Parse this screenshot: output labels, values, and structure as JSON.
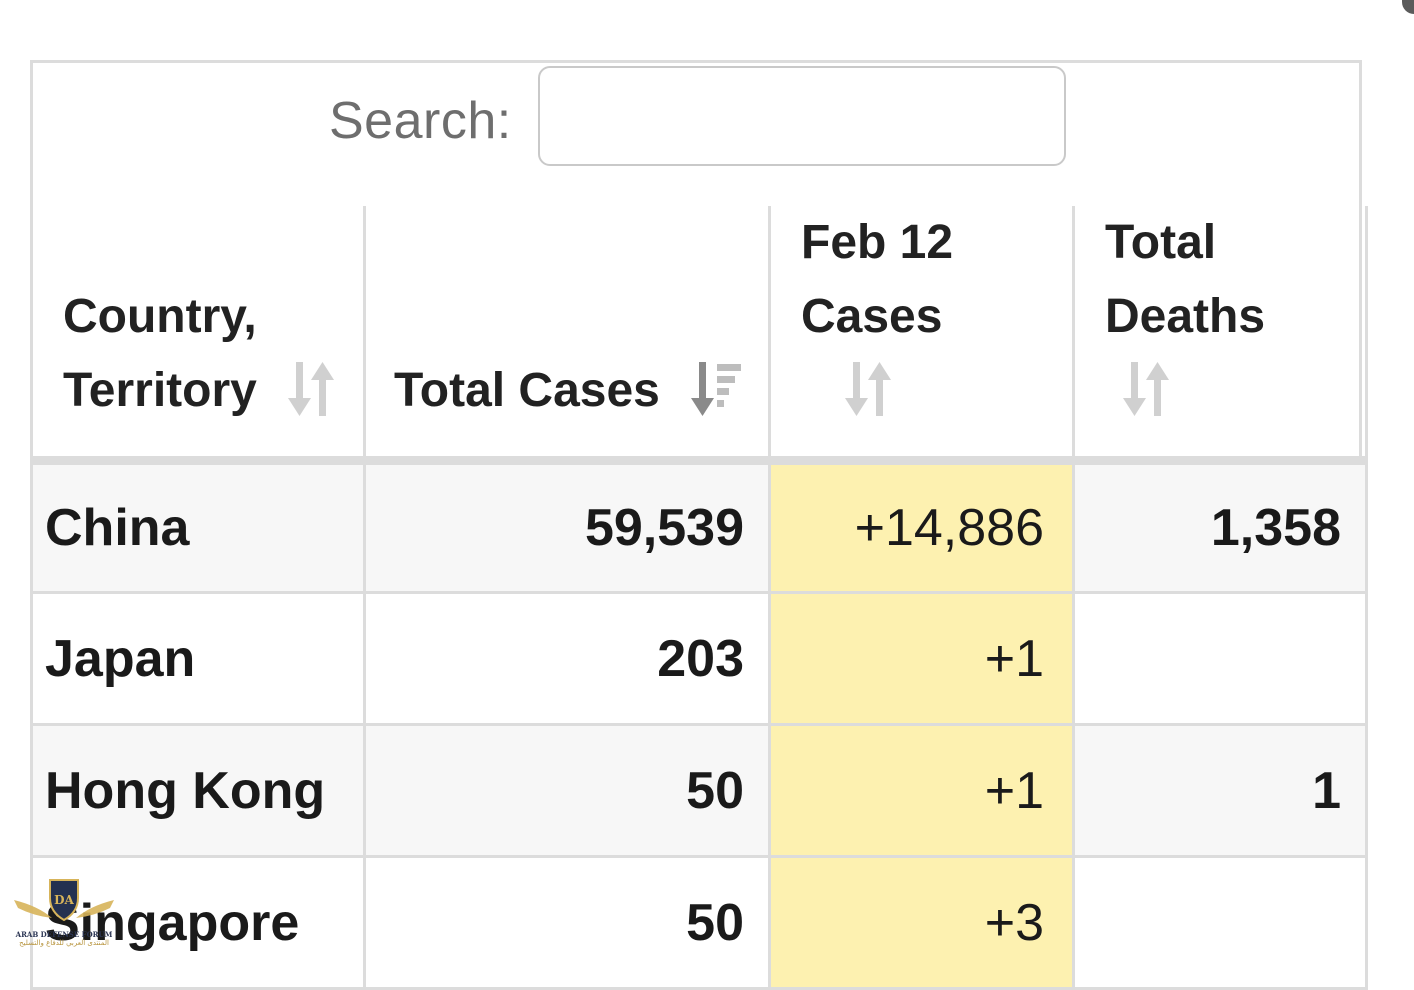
{
  "search": {
    "label": "Search:",
    "value": "",
    "placeholder": ""
  },
  "table": {
    "columns": [
      {
        "line1": "Country,",
        "line2": "Territory",
        "sort": "unsorted"
      },
      {
        "line1": "",
        "line2": "Total Cases",
        "sort": "descending"
      },
      {
        "line1": "Feb 12",
        "line2": "Cases",
        "sort": "unsorted"
      },
      {
        "line1": "Total",
        "line2": "Deaths",
        "sort": "unsorted"
      }
    ],
    "rows": [
      {
        "country": "China",
        "total_cases": "59,539",
        "new_cases": "+14,886",
        "total_deaths": "1,358"
      },
      {
        "country": "Japan",
        "total_cases": "203",
        "new_cases": "+1",
        "total_deaths": ""
      },
      {
        "country": "Hong Kong",
        "total_cases": "50",
        "new_cases": "+1",
        "total_deaths": "1"
      },
      {
        "country": "Singapore",
        "total_cases": "50",
        "new_cases": "+3",
        "total_deaths": ""
      }
    ]
  },
  "colors": {
    "highlight": "#fdf1b0",
    "border": "#dcdcdc",
    "stripe": "#f7f7f7",
    "sort_icon": "#c9c9c9",
    "sort_icon_active": "#888888"
  },
  "watermark": {
    "monogram": "DA",
    "line1": "ARAB DEFENSE FORUM",
    "line2": "المنتدى العربي للدفاع والتسليح"
  }
}
